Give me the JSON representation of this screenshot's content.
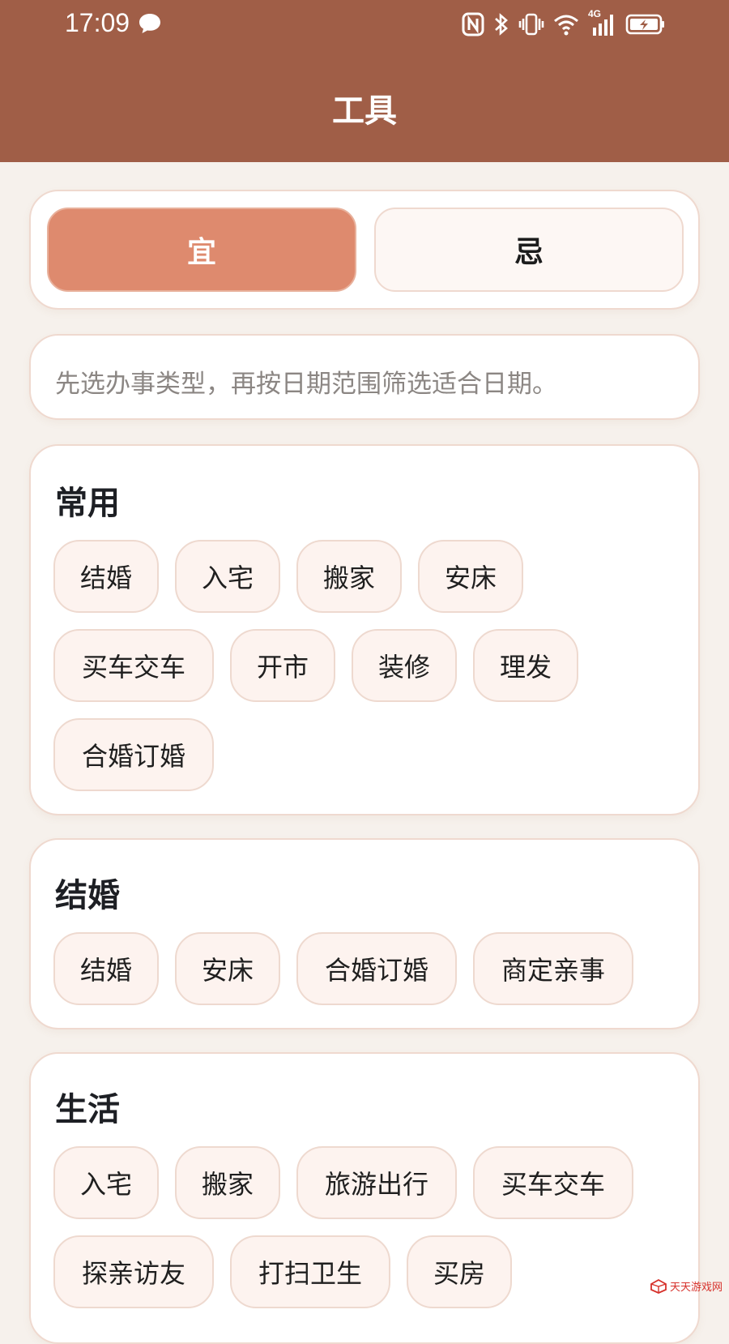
{
  "status_bar": {
    "time": "17:09",
    "network": "4G"
  },
  "header": {
    "title": "工具"
  },
  "tabs": [
    {
      "label": "宜",
      "active": true
    },
    {
      "label": "忌",
      "active": false
    }
  ],
  "hint": {
    "text": "先选办事类型，再按日期范围筛选适合日期。"
  },
  "sections": [
    {
      "title": "常用",
      "items": [
        "结婚",
        "入宅",
        "搬家",
        "安床",
        "买车交车",
        "开市",
        "装修",
        "理发",
        "合婚订婚"
      ]
    },
    {
      "title": "结婚",
      "items": [
        "结婚",
        "安床",
        "合婚订婚",
        "商定亲事"
      ]
    },
    {
      "title": "生活",
      "items": [
        "入宅",
        "搬家",
        "旅游出行",
        "买车交车",
        "探亲访友",
        "打扫卫生",
        "买房"
      ]
    }
  ],
  "watermark": {
    "text": "天天游戏网"
  },
  "colors": {
    "header_bg": "#a05e47",
    "active_tab": "#de8a6e",
    "page_bg": "#f6f1ec",
    "chip_bg": "#fdf3ef"
  }
}
